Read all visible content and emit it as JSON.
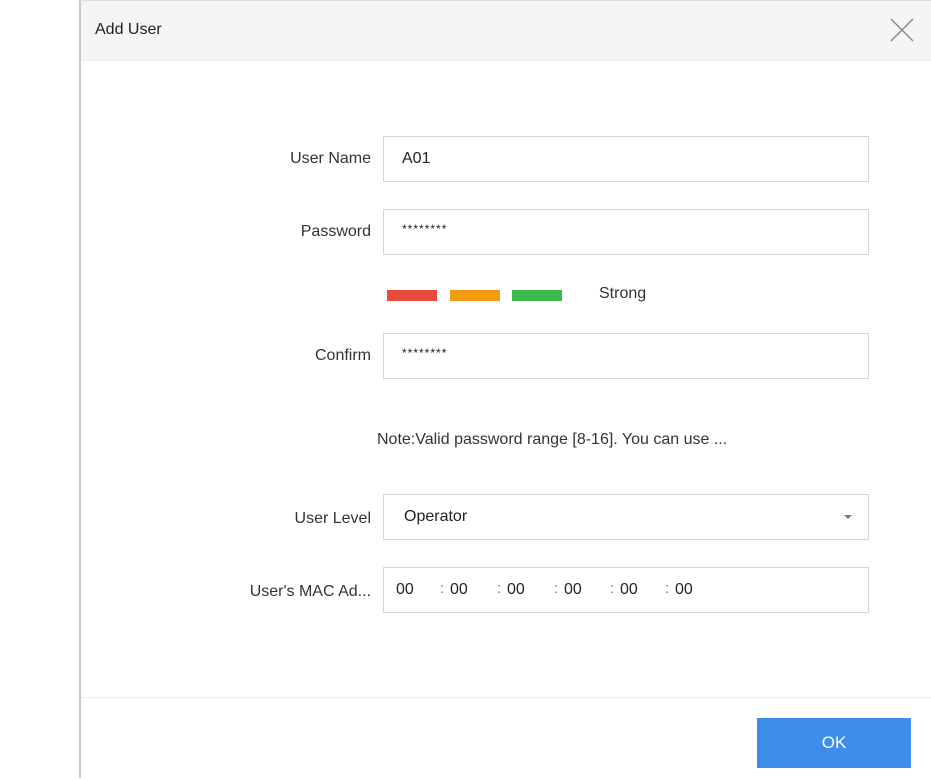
{
  "dialog": {
    "title": "Add User",
    "close_icon": "close-icon"
  },
  "form": {
    "user_name": {
      "label": "User Name",
      "value": "A01"
    },
    "password": {
      "label": "Password",
      "value": "********"
    },
    "strength": {
      "label": "Strong",
      "bars": [
        "#e84c3d",
        "#f39c12",
        "#3cb94a"
      ]
    },
    "confirm": {
      "label": "Confirm",
      "value": "********"
    },
    "note": "Note:Valid password range [8-16]. You can use ...",
    "user_level": {
      "label": "User Level",
      "value": "Operator",
      "icon": "chevron-down-icon"
    },
    "mac": {
      "label": "User's MAC Ad...",
      "segments": [
        "00",
        "00",
        "00",
        "00",
        "00",
        "00"
      ],
      "separator": ":"
    }
  },
  "footer": {
    "ok_label": "OK",
    "ok_color": "#3d8ee8"
  }
}
